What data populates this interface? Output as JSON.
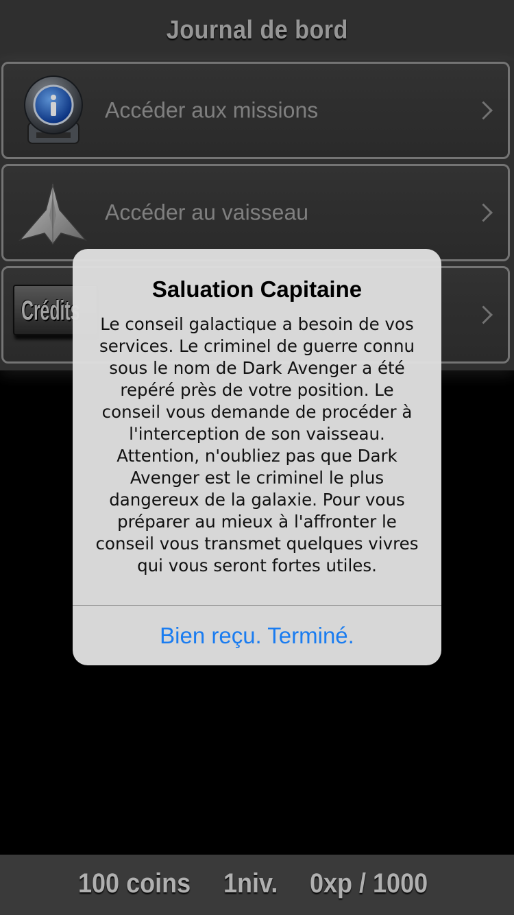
{
  "header": {
    "title": "Journal de bord"
  },
  "menu": {
    "items": [
      {
        "label": "Accéder aux missions",
        "icon": "mission-info-icon"
      },
      {
        "label": "Accéder au vaisseau",
        "icon": "spaceship-icon"
      },
      {
        "label": "",
        "icon": "credits-icon",
        "icon_text": "Crédits"
      }
    ]
  },
  "alert": {
    "title": "Saluation Capitaine",
    "message": "Le conseil galactique a besoin de vos services. Le criminel de guerre connu sous le nom de Dark Avenger a été repéré près de votre position. Le conseil vous demande de procéder à l'interception de son vaisseau. Attention, n'oubliez pas que Dark Avenger est le criminel le plus dangereux de la galaxie. Pour vous préparer au mieux à l'affronter le conseil vous transmet quelques vivres qui vous seront fortes utiles.",
    "button_label": "Bien reçu. Terminé."
  },
  "footer": {
    "coins": "100 coins",
    "level": "1niv.",
    "xp": "0xp / 1000"
  },
  "colors": {
    "bar_background": "#3a3a3a",
    "alert_button": "#1a7cf0",
    "row_border": "#8e8e8e"
  }
}
